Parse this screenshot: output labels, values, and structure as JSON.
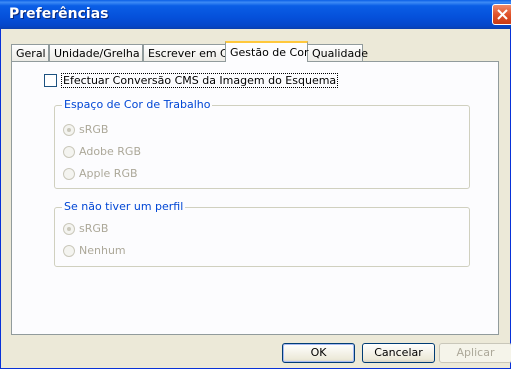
{
  "window": {
    "title": "Preferências"
  },
  "tabs": [
    {
      "label": "Geral"
    },
    {
      "label": "Unidade/Grelha"
    },
    {
      "label": "Escrever em CD"
    },
    {
      "label": "Gestão de Cor",
      "active": true
    },
    {
      "label": "Qualidade"
    }
  ],
  "panel": {
    "cms_checkbox": {
      "label": "Efectuar Conversão CMS da Imagem do Esquema",
      "checked": false
    },
    "working_space": {
      "title": "Espaço de Cor de Trabalho",
      "options": [
        {
          "label": "sRGB",
          "checked": true
        },
        {
          "label": "Adobe RGB",
          "checked": false
        },
        {
          "label": "Apple RGB",
          "checked": false
        }
      ]
    },
    "no_profile": {
      "title": "Se não tiver um perfil",
      "options": [
        {
          "label": "sRGB",
          "checked": true
        },
        {
          "label": "Nenhum",
          "checked": false
        }
      ]
    }
  },
  "buttons": {
    "ok": "OK",
    "cancel": "Cancelar",
    "apply": "Aplicar"
  },
  "colors": {
    "titlebar": "#0550da",
    "group_title": "#0046d5",
    "active_tab_highlight": "#ffc83c"
  }
}
